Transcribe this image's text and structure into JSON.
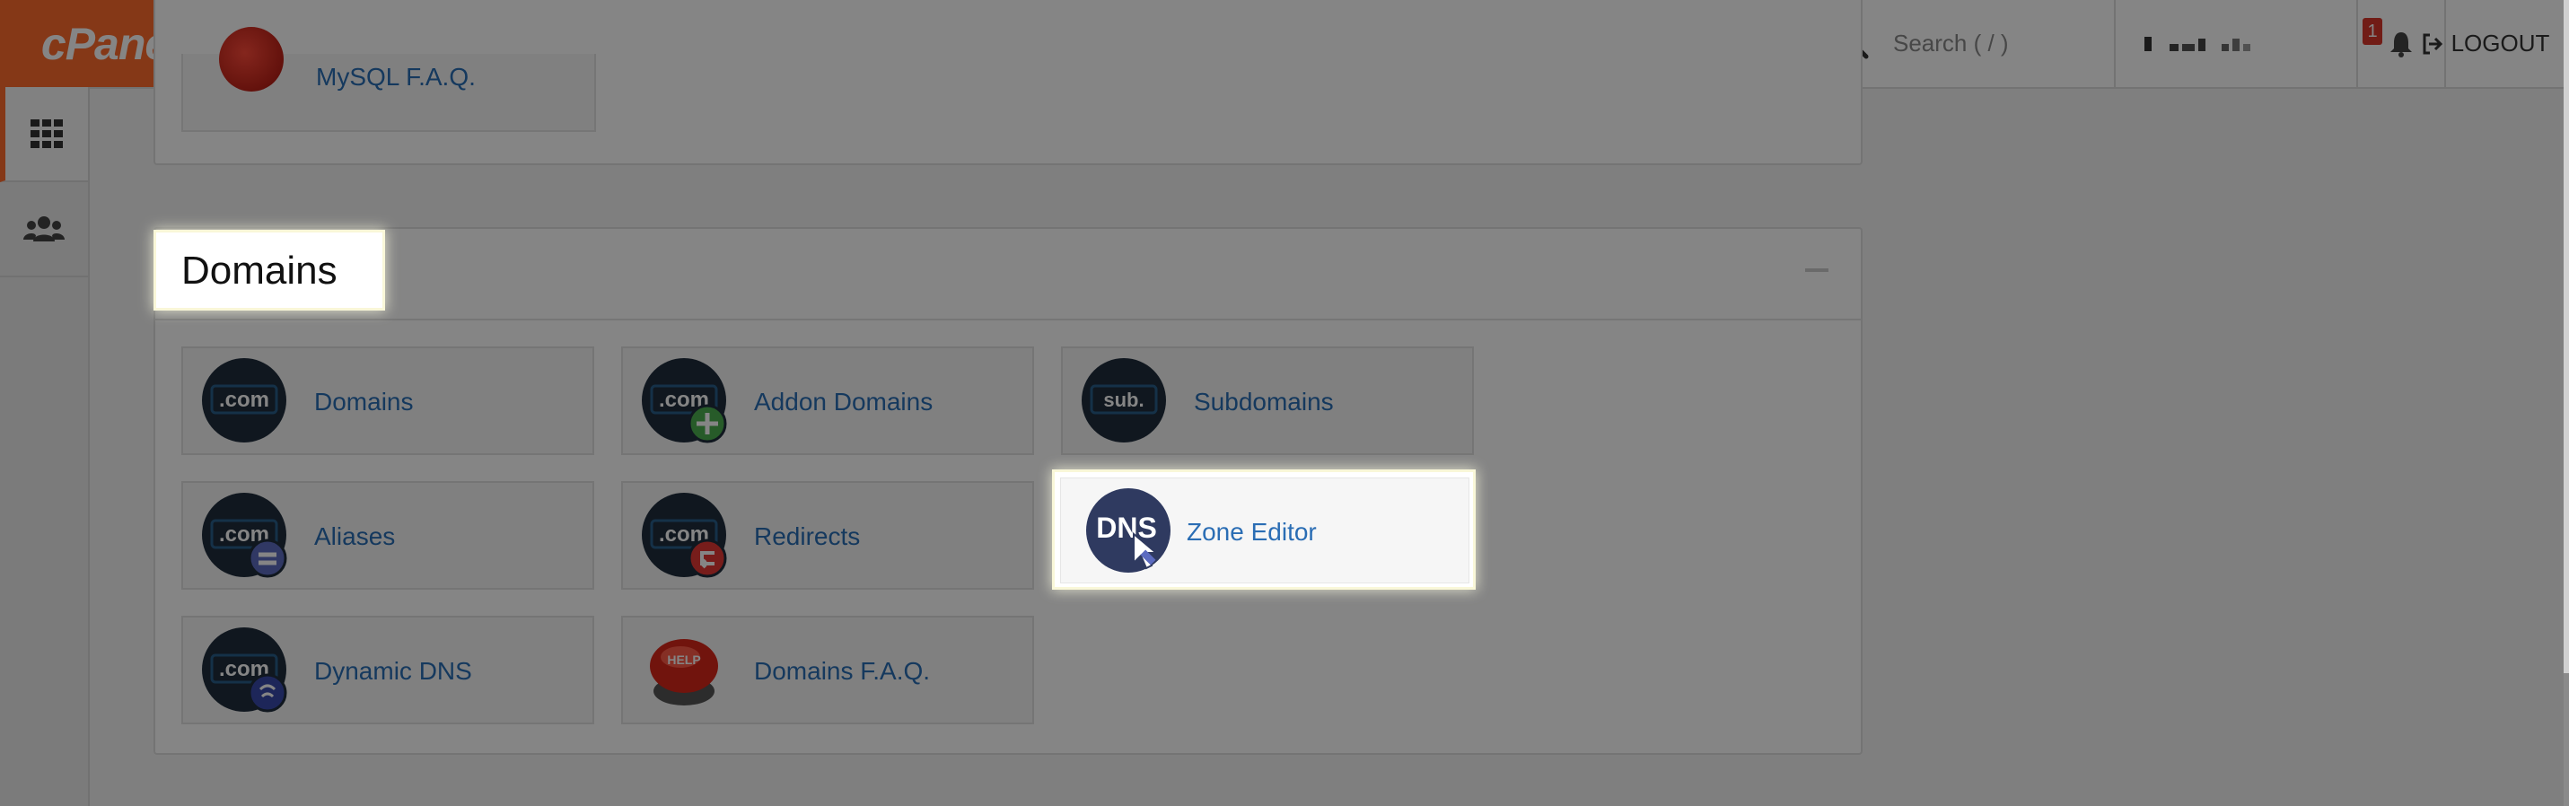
{
  "brand": {
    "logo_text": "cPanel",
    "accent": "#ff6c2c"
  },
  "header": {
    "search_placeholder": "Search ( / )",
    "notifications_count": "1",
    "logout_label": "LOGOUT"
  },
  "sidebar": {
    "items": [
      {
        "icon": "apps-grid-icon",
        "active": true
      },
      {
        "icon": "users-icon",
        "active": false
      }
    ]
  },
  "previous_section": {
    "item_label": "MySQL F.A.Q."
  },
  "domains_section": {
    "title": "Domains",
    "items": [
      {
        "label": "Domains",
        "icon": "dot-com-icon"
      },
      {
        "label": "Addon Domains",
        "icon": "dot-com-add-icon"
      },
      {
        "label": "Subdomains",
        "icon": "subdomain-icon"
      },
      {
        "label": "Aliases",
        "icon": "dot-com-alias-icon"
      },
      {
        "label": "Redirects",
        "icon": "dot-com-redirect-icon"
      },
      {
        "label": "Zone Editor",
        "icon": "dns-zone-icon"
      },
      {
        "label": "Dynamic DNS",
        "icon": "dot-com-dynamic-icon"
      },
      {
        "label": "Domains F.A.Q.",
        "icon": "help-button-icon"
      }
    ]
  },
  "highlight": {
    "title": "Domains",
    "target": "Zone Editor"
  }
}
